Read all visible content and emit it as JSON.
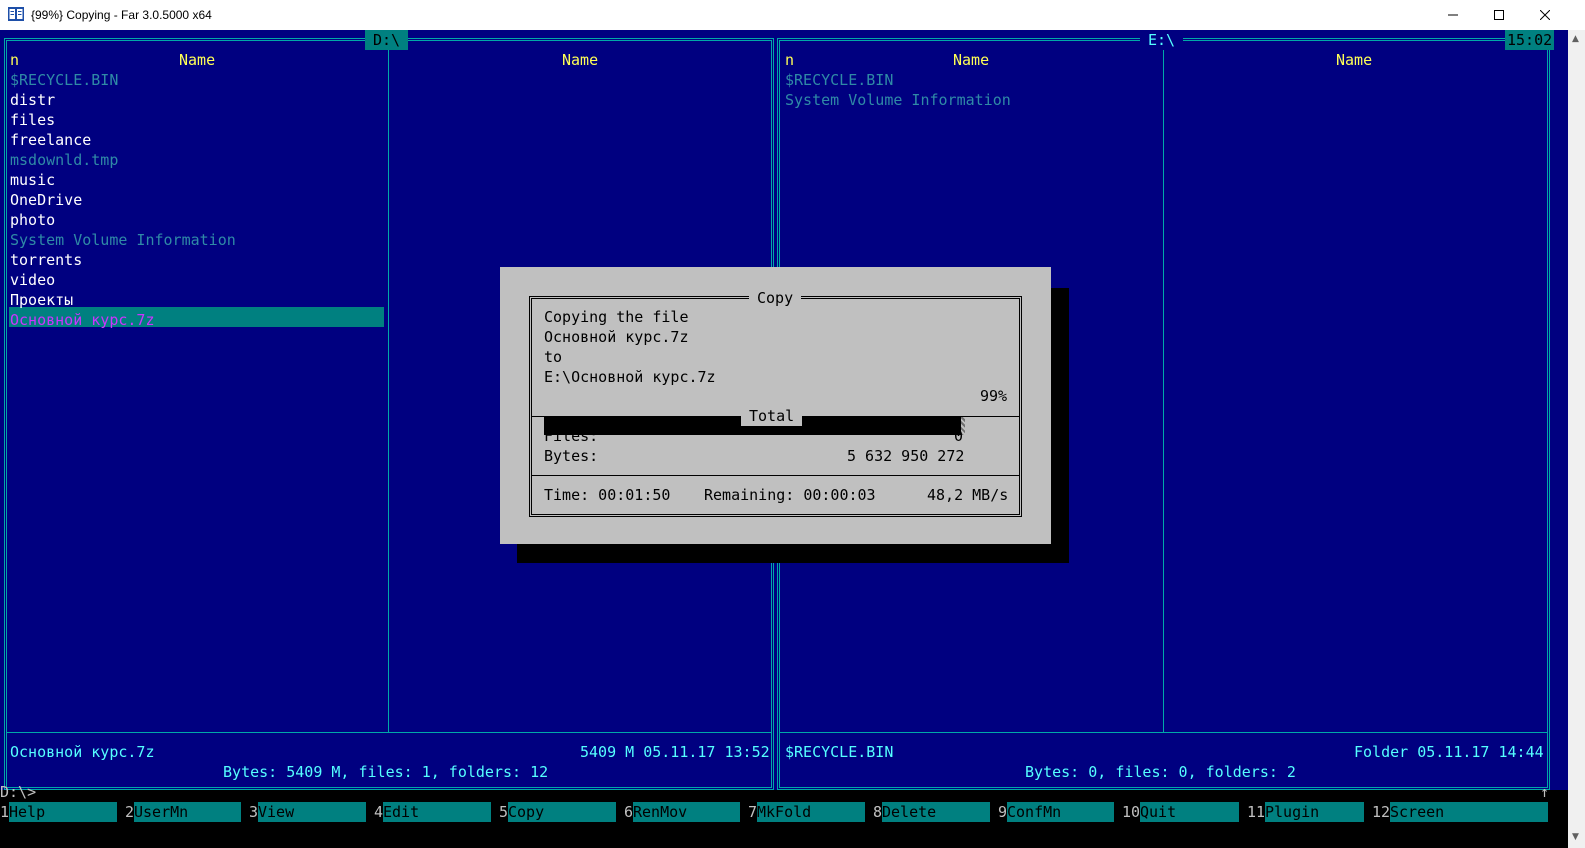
{
  "window": {
    "title": "{99%} Copying - Far 3.0.5000 x64",
    "minimize": "—",
    "maximize": "☐",
    "close": "✕"
  },
  "left_panel": {
    "path": "D:\\",
    "col1_mode": "n",
    "col1_header": "Name",
    "col2_header": "Name",
    "files": [
      {
        "name": "$RECYCLE.BIN",
        "style": "hidden"
      },
      {
        "name": "distr",
        "style": "normal"
      },
      {
        "name": "files",
        "style": "normal"
      },
      {
        "name": "freelance",
        "style": "normal"
      },
      {
        "name": "msdownld.tmp",
        "style": "hidden"
      },
      {
        "name": "music",
        "style": "normal"
      },
      {
        "name": "OneDrive",
        "style": "normal"
      },
      {
        "name": "photo",
        "style": "normal"
      },
      {
        "name": "System Volume Information",
        "style": "hidden"
      },
      {
        "name": "torrents",
        "style": "normal"
      },
      {
        "name": "video",
        "style": "normal"
      },
      {
        "name": "Проекты",
        "style": "normal"
      },
      {
        "name": "Основной курс.7z",
        "style": "selected"
      }
    ],
    "status_name": "Основной курс.7z",
    "status_info": "5409 M 05.11.17 13:52",
    "summary": " Bytes: 5409 M, files: 1, folders: 12 "
  },
  "right_panel": {
    "path": "E:\\",
    "clock": "15:02",
    "col1_mode": "n",
    "col1_header": "Name",
    "col2_header": "Name",
    "files": [
      {
        "name": "$RECYCLE.BIN",
        "style": "hidden"
      },
      {
        "name": "System Volume Information",
        "style": "hidden"
      }
    ],
    "status_name": "$RECYCLE.BIN",
    "status_info": "Folder 05.11.17 14:44",
    "summary": " Bytes: 0, files: 0, folders: 2 "
  },
  "copy_dialog": {
    "title": "Copy",
    "line1": "Copying the file",
    "line2": "Основной курс.7z",
    "line3": "to",
    "line4": "E:\\Основной курс.7z",
    "progress_fraction": 0.99,
    "progress_text": "99%",
    "total_label": "Total",
    "files_label": "Files:",
    "files_value": "0",
    "bytes_label": "Bytes:",
    "bytes_value": "5 632 950 272",
    "time_text": "Time: 00:01:50",
    "remaining_text": "Remaining: 00:00:03",
    "speed_text": "48,2 MB/s"
  },
  "command_line": {
    "prompt": "D:\\>",
    "scroll_marker": "↑"
  },
  "keybar": [
    {
      "num": "1",
      "label": "Help"
    },
    {
      "num": "2",
      "label": "UserMn"
    },
    {
      "num": "3",
      "label": "View"
    },
    {
      "num": "4",
      "label": "Edit"
    },
    {
      "num": "5",
      "label": "Copy"
    },
    {
      "num": "6",
      "label": "RenMov"
    },
    {
      "num": "7",
      "label": "MkFold"
    },
    {
      "num": "8",
      "label": "Delete"
    },
    {
      "num": "9",
      "label": "ConfMn"
    },
    {
      "num": "10",
      "label": "Quit"
    },
    {
      "num": "11",
      "label": "Plugin"
    },
    {
      "num": "12",
      "label": "Screen"
    }
  ],
  "colors": {
    "panel_bg": "#000080",
    "border": "#00a8a8",
    "header": "#ffff55",
    "file_normal": "#ffffff",
    "file_hidden": "#2f8aa6",
    "selection_bg": "#008080",
    "selection_fg": "#cc33ff",
    "dialog_bg": "#c0c0c0"
  }
}
